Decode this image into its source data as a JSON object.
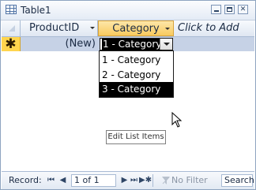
{
  "window": {
    "title": "Table1"
  },
  "columns": {
    "product_id": "ProductID",
    "category": "Category",
    "add": "Click to Add"
  },
  "new_row": {
    "selector_glyph": "✱",
    "product_id_value": "(New)",
    "category_value": "1 - Category"
  },
  "dropdown": {
    "options": [
      "1 - Category",
      "2 - Category",
      "3 - Category"
    ],
    "highlighted_index": 2
  },
  "edit_list_button": {
    "label": "Edit List Items"
  },
  "navigation": {
    "record_label": "Record:",
    "position": "1 of 1",
    "filter_label": "No Filter",
    "search_placeholder": "Search"
  },
  "colors": {
    "selected_header": "#f8ca5f",
    "new_row_selector": "#ffd54d",
    "row_highlight": "#c6d2e6"
  }
}
